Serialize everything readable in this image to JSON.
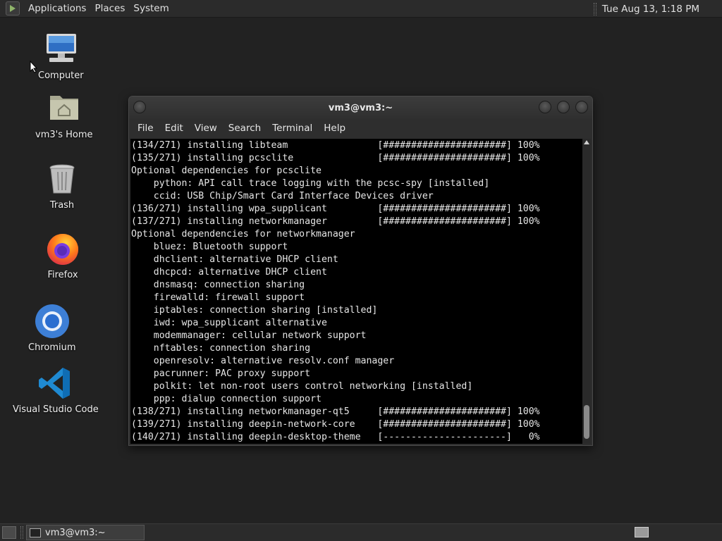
{
  "top_panel": {
    "menus": [
      "Applications",
      "Places",
      "System"
    ],
    "clock": "Tue Aug 13,  1:18 PM"
  },
  "desktop_icons": [
    {
      "label": "Computer",
      "icon": "computer-icon"
    },
    {
      "label": "vm3's Home",
      "icon": "home-folder-icon"
    },
    {
      "label": "Trash",
      "icon": "trash-icon"
    },
    {
      "label": "Firefox",
      "icon": "firefox-icon"
    },
    {
      "label": "Chromium",
      "icon": "chromium-icon"
    },
    {
      "label": "Visual Studio Code",
      "icon": "vscode-icon"
    }
  ],
  "terminal": {
    "title": "vm3@vm3:~",
    "menu": [
      "File",
      "Edit",
      "View",
      "Search",
      "Terminal",
      "Help"
    ],
    "lines": [
      "(134/271) installing libteam                [######################] 100%",
      "(135/271) installing pcsclite               [######################] 100%",
      "Optional dependencies for pcsclite",
      "    python: API call trace logging with the pcsc-spy [installed]",
      "    ccid: USB Chip/Smart Card Interface Devices driver",
      "(136/271) installing wpa_supplicant         [######################] 100%",
      "(137/271) installing networkmanager         [######################] 100%",
      "Optional dependencies for networkmanager",
      "    bluez: Bluetooth support",
      "    dhclient: alternative DHCP client",
      "    dhcpcd: alternative DHCP client",
      "    dnsmasq: connection sharing",
      "    firewalld: firewall support",
      "    iptables: connection sharing [installed]",
      "    iwd: wpa_supplicant alternative",
      "    modemmanager: cellular network support",
      "    nftables: connection sharing",
      "    openresolv: alternative resolv.conf manager",
      "    pacrunner: PAC proxy support",
      "    polkit: let non-root users control networking [installed]",
      "    ppp: dialup connection support",
      "(138/271) installing networkmanager-qt5     [######################] 100%",
      "(139/271) installing deepin-network-core    [######################] 100%",
      "(140/271) installing deepin-desktop-theme   [----------------------]   0%"
    ]
  },
  "bottom_panel": {
    "task_label": "vm3@vm3:~"
  }
}
